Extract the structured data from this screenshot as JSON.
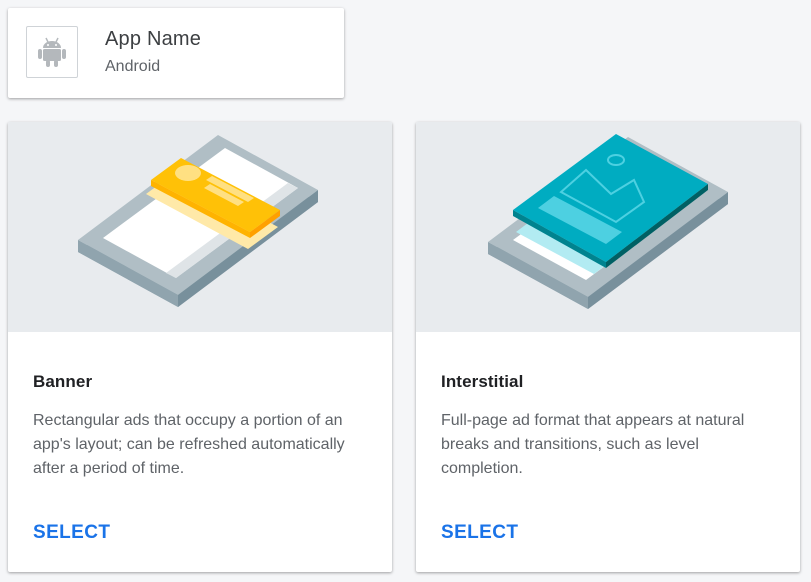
{
  "app": {
    "name": "App Name",
    "platform": "Android",
    "icon": "android-icon"
  },
  "formats": [
    {
      "title": "Banner",
      "description": "Rectangular ads that occupy a portion of an app's layout; can be refreshed automatically after a period of time.",
      "action": "SELECT",
      "illustration": "banner-illustration"
    },
    {
      "title": "Interstitial",
      "description": "Full-page ad format that appears at natural breaks and transitions, such as level completion.",
      "action": "SELECT",
      "illustration": "interstitial-illustration"
    }
  ],
  "colors": {
    "accent": "#1a73e8",
    "banner_yellow": "#ffc107",
    "interstitial_teal": "#00acc1",
    "phone_gray": "#b0bec5"
  }
}
